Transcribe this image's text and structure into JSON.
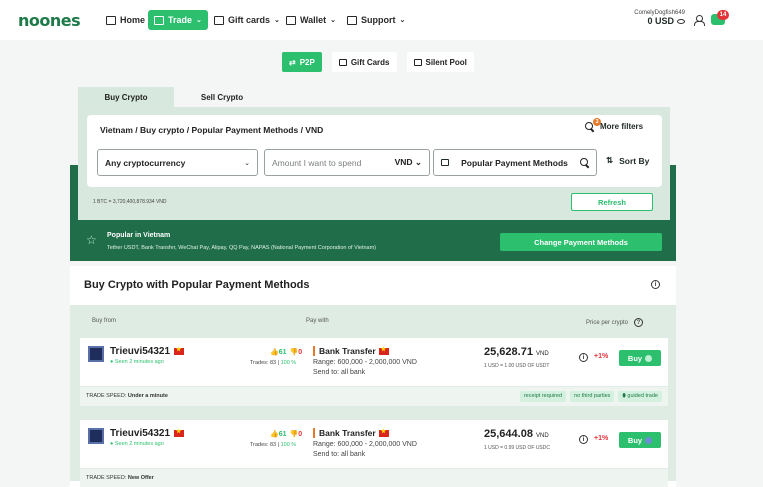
{
  "nav": {
    "logo": "noones",
    "items": [
      {
        "label": "Home"
      },
      {
        "label": "Trade"
      },
      {
        "label": "Gift cards"
      },
      {
        "label": "Wallet"
      },
      {
        "label": "Support"
      }
    ],
    "username": "ComelyDogfish649",
    "balance": "0 USD",
    "notifications": "14"
  },
  "modes": [
    "P2P",
    "Gift Cards",
    "Silent Pool"
  ],
  "side_tabs": [
    "Buy Crypto",
    "Sell Crypto"
  ],
  "search": {
    "breadcrumb": "Vietnam / Buy crypto / Popular Payment Methods / VND",
    "more_filters": "More filters",
    "filters_count": "3",
    "crypto": "Any cryptocurrency",
    "amount_placeholder": "Amount I want to spend",
    "currency": "VND",
    "payment": "Popular Payment Methods",
    "sort_by": "Sort By",
    "rate": "1 BTC = 3,720,400,878.934 VND",
    "refresh": "Refresh"
  },
  "popular": {
    "title": "Popular in Vietnam",
    "methods": "Tether USDT, Bank Transfer, WeChat Pay, Alipay, QQ Pay, NAPAS (National Payment Corporation of Vietnam)",
    "change_button": "Change Payment Methods"
  },
  "offers": {
    "title": "Buy Crypto with Popular Payment Methods",
    "col_buy_from": "Buy from",
    "col_pay_with": "Pay with",
    "col_price": "Price per crypto",
    "rows": [
      {
        "user": "Trieuvi54321",
        "seen": "● Seen 2 minutes ago",
        "positive": "👍61",
        "negative": "👎0",
        "trades": "Trades: 83 | ",
        "trades_pct": "100 %",
        "method": "Bank Transfer",
        "range": "Range: 600,000 - 2,000,000 VND",
        "send_to": "Send to: all bank",
        "price": "25,628.71",
        "price_unit": "VND",
        "rate": "1 USD = 1.00 USD OF USDT",
        "margin": "+1%",
        "buy": "Buy",
        "speed_label": "TRADE SPEED:",
        "speed": "Under a minute",
        "tags": [
          "receipt required",
          "no third parties",
          "guided trade"
        ]
      },
      {
        "user": "Trieuvi54321",
        "seen": "● Seen 2 minutes ago",
        "positive": "👍61",
        "negative": "👎0",
        "trades": "Trades: 83 | ",
        "trades_pct": "100 %",
        "method": "Bank Transfer",
        "range": "Range: 600,000 - 2,000,000 VND",
        "send_to": "Send to: all bank",
        "price": "25,644.08",
        "price_unit": "VND",
        "rate": "1 USD = 0.99 USD OF USDC",
        "margin": "+1%",
        "buy": "Buy",
        "speed_label": "TRADE SPEED:",
        "speed": "New Offer",
        "tags": []
      }
    ]
  },
  "colors": {
    "brand": "#2bbf6e",
    "dark_band": "#1f6d49",
    "negative": "#e5333a"
  }
}
